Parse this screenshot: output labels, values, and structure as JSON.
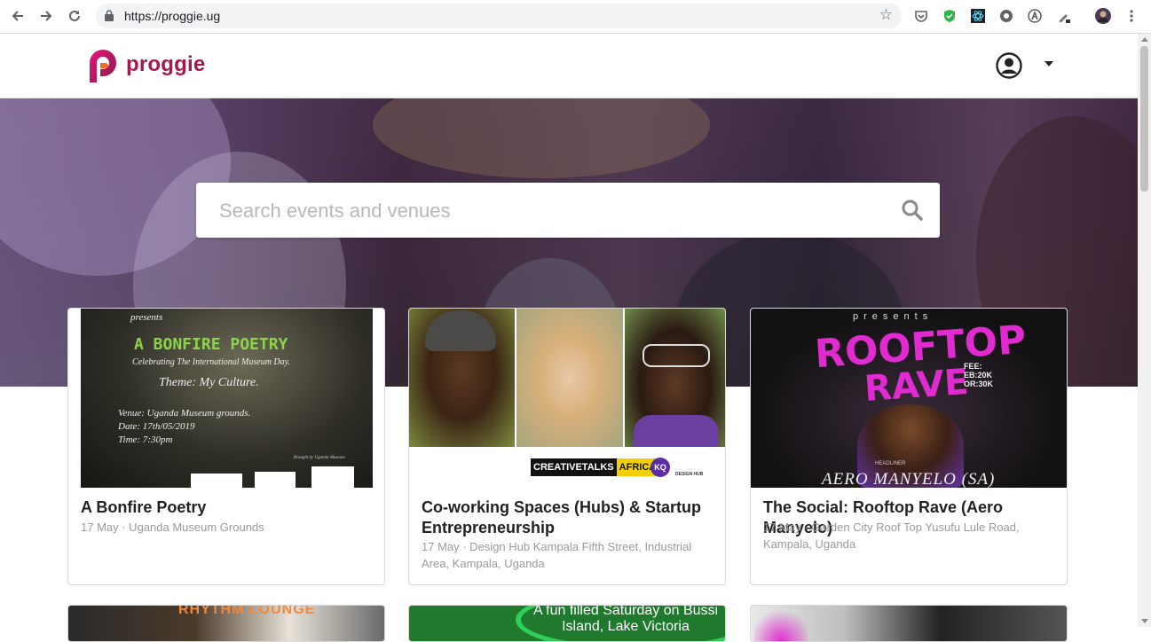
{
  "browser": {
    "url": "https://proggie.ug"
  },
  "site": {
    "logo_text": "proggie",
    "brand_color": "#a8164e"
  },
  "search": {
    "placeholder": "Search events and venues"
  },
  "events": [
    {
      "title": "A Bonfire Poetry",
      "meta": "17 May · Uganda Museum Grounds",
      "poster": {
        "presents": "presents",
        "headline": "A BONFIRE POETRY",
        "subtitle": "Celebrating The International Museum Day.",
        "theme": "Theme: My Culture.",
        "venue": "Venue: Uganda Museum grounds.",
        "date": "Date: 17th/05/2019",
        "time": "Time: 7:30pm",
        "credit": "Brought by Uganda Museum"
      }
    },
    {
      "title": "Co-working Spaces (Hubs) & Startup Entrepreneurship",
      "meta": "17 May · Design Hub Kampala Fifth Street, Industrial Area, Kampala, Uganda",
      "poster": {
        "brand_a": "CREATIVETALKS",
        "brand_b": "AFRICA",
        "kq": "KQ",
        "designhub": "DESIGN HUB"
      }
    },
    {
      "title": "The Social: Rooftop Rave (Aero Manyelo)",
      "meta": "17 May · Garden City Roof Top Yusufu Lule Road, Kampala, Uganda",
      "poster": {
        "presents": "presents",
        "headline_1": "ROOFTOP",
        "headline_2": "RAVE",
        "fees": "FEE: EB:20K OR:30K",
        "headliner": "HEADLINER",
        "artist": "AERO MANYELO (SA)"
      }
    }
  ],
  "more_events": [
    {
      "poster_text": "RHYTHM LOUNGE"
    },
    {
      "poster_text": "A fun filled Saturday on Bussi Island, Lake Victoria"
    },
    {
      "poster_text": ""
    }
  ]
}
